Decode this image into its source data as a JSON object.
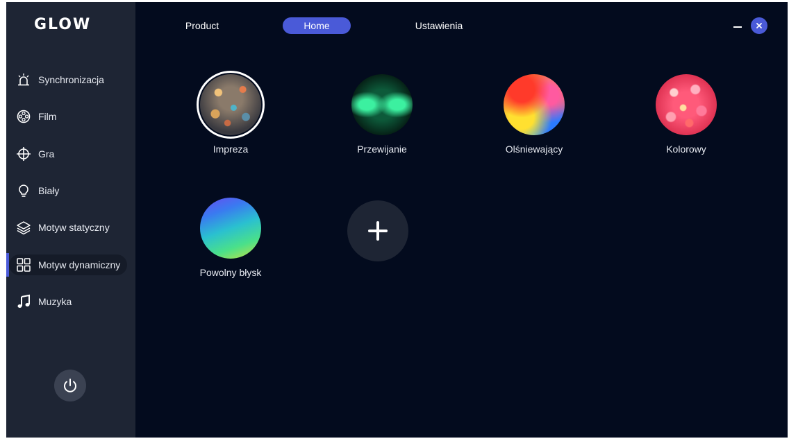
{
  "app": {
    "logo": "GLOW"
  },
  "topnav": [
    {
      "label": "Product",
      "active": false
    },
    {
      "label": "Home",
      "active": true
    },
    {
      "label": "Ustawienia",
      "active": false
    }
  ],
  "sidebar": {
    "items": [
      {
        "label": "Synchronizacja",
        "icon": "alarm-icon"
      },
      {
        "label": "Film",
        "icon": "film-reel-icon"
      },
      {
        "label": "Gra",
        "icon": "crosshair-icon"
      },
      {
        "label": "Biały",
        "icon": "lightbulb-icon"
      },
      {
        "label": "Motyw statyczny",
        "icon": "layers-icon"
      },
      {
        "label": "Motyw dynamiczny",
        "icon": "grid-icon",
        "active": true
      },
      {
        "label": "Muzyka",
        "icon": "music-note-icon"
      }
    ],
    "power_icon": "power-icon"
  },
  "themes": [
    {
      "label": "Impreza",
      "selected": true
    },
    {
      "label": "Przewijanie",
      "selected": false
    },
    {
      "label": "Olśniewający",
      "selected": false
    },
    {
      "label": "Kolorowy",
      "selected": false
    },
    {
      "label": "Powolny błysk",
      "selected": false
    }
  ],
  "colors": {
    "accent": "#4a5ad8",
    "sidebar_bg": "#1e2534",
    "main_bg": "#030b1e"
  }
}
